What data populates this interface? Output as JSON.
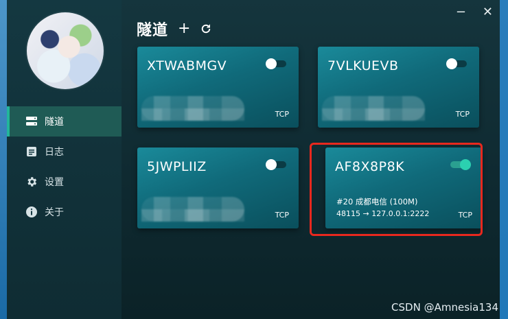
{
  "sidebar": {
    "items": [
      {
        "label": "隧道",
        "icon": "server-icon",
        "active": true
      },
      {
        "label": "日志",
        "icon": "document-icon",
        "active": false
      },
      {
        "label": "设置",
        "icon": "gear-icon",
        "active": false
      },
      {
        "label": "关于",
        "icon": "info-icon",
        "active": false
      }
    ]
  },
  "header": {
    "title": "隧道",
    "add_label": "+",
    "refresh_icon": "refresh-icon",
    "minimize_label": "−",
    "close_label": "✕"
  },
  "tunnels": [
    {
      "name": "XTWABMGV",
      "protocol": "TCP",
      "enabled": false,
      "description": "",
      "address": ""
    },
    {
      "name": "7VLKUEVB",
      "protocol": "TCP",
      "enabled": false,
      "description": "",
      "address": ""
    },
    {
      "name": "5JWPLIIZ",
      "protocol": "TCP",
      "enabled": false,
      "description": "",
      "address": ""
    },
    {
      "name": "AF8X8P8K",
      "protocol": "TCP",
      "enabled": true,
      "description": "#20 成都电信 (100M)",
      "address": "48115 → 127.0.0.1:2222"
    }
  ],
  "watermark": "CSDN @Amnesia134",
  "colors": {
    "accent": "#22b69a",
    "highlight": "#e8281e",
    "card": "#106a7a"
  }
}
